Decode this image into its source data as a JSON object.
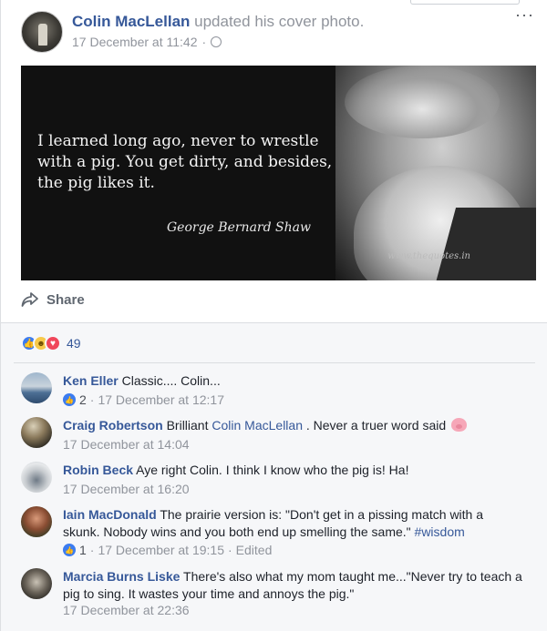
{
  "post": {
    "author": "Colin MacLellan",
    "action": " updated his cover photo.",
    "date": "17 December at 11:42",
    "dot": "·",
    "more": "···"
  },
  "photo": {
    "quote": "I learned long ago, never to wrestle with a pig. You get dirty, and besides, the pig likes it.",
    "quote_author": "George Bernard Shaw",
    "watermark": "www.thequotes.in"
  },
  "share": {
    "label": "Share"
  },
  "reactions": {
    "count": "49"
  },
  "comments": [
    {
      "name": "Ken Eller",
      "text": " Classic.... Colin...",
      "likes": "2",
      "date": "17 December at 12:17"
    },
    {
      "name": "Craig Robertson",
      "text_before": " Brilliant ",
      "mention": "Colin MacLellan",
      "text_after": " . Never a truer word said ",
      "date": "17 December at 14:04"
    },
    {
      "name": "Robin Beck",
      "text": " Aye right Colin. I think I know who the pig is! Ha!",
      "date": "17 December at 16:20"
    },
    {
      "name": "Iain MacDonald",
      "text": " The prairie version is: \"Don't get in a pissing match with a skunk. Nobody wins and you both end up smelling the same.\" ",
      "hashtag": "#wisdom",
      "likes": "1",
      "date": "17 December at 19:15",
      "edited": "Edited"
    },
    {
      "name": "Marcia Burns Liske",
      "text": " There's also what my mom taught me...\"Never try to teach a pig to sing. It wastes your time and annoys the pig.\"",
      "date": "17 December at 22:36"
    }
  ]
}
